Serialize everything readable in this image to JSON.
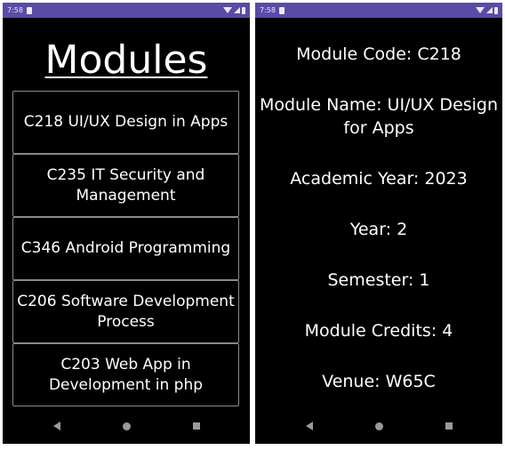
{
  "status_bar": {
    "time": "7:58"
  },
  "list_screen": {
    "title": "Modules",
    "modules": [
      "C218 UI/UX Design in Apps",
      "C235 IT Security and Management",
      "C346 Android Programming",
      "C206 Software Development Process",
      "C203 Web App in Development in php"
    ]
  },
  "detail_screen": {
    "code": "Module Code: C218",
    "name": "Module Name: UI/UX Design for Apps",
    "academic_year": "Academic Year: 2023",
    "year": "Year: 2",
    "semester": "Semester: 1",
    "credits": "Module Credits: 4",
    "venue": "Venue: W65C"
  },
  "icons": {
    "status": [
      "sim-card-icon",
      "wifi-icon",
      "signal-icon",
      "battery-icon"
    ],
    "nav": [
      "back-icon",
      "home-icon",
      "recent-apps-icon"
    ]
  },
  "colors": {
    "status_bar": "#5b4aa6",
    "background": "#000000",
    "text": "#ffffff",
    "item_border": "#8a8a8a",
    "nav_icons": "#9a9a9a"
  }
}
